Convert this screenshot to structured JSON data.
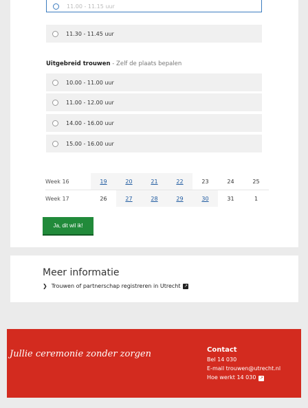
{
  "slots_top": [
    {
      "label": "11.00 - 11.15 uur",
      "selected": true
    },
    {
      "label": "11.30 - 11.45 uur",
      "selected": false
    }
  ],
  "uitgebreid": {
    "title": "Uitgebreid trouwen",
    "subtitle": " - Zelf de plaats bepalen",
    "slots": [
      "10.00 - 11.00 uur",
      "11.00 - 12.00 uur",
      "14.00 - 16.00 uur",
      "15.00 - 16.00 uur"
    ]
  },
  "weeks": [
    {
      "label": "Week 16",
      "days": [
        {
          "d": "19",
          "available": true
        },
        {
          "d": "20",
          "available": true
        },
        {
          "d": "21",
          "available": true
        },
        {
          "d": "22",
          "available": true
        },
        {
          "d": "23",
          "available": false
        },
        {
          "d": "24",
          "available": false
        },
        {
          "d": "25",
          "available": false
        }
      ]
    },
    {
      "label": "Week 17",
      "days": [
        {
          "d": "26",
          "available": false
        },
        {
          "d": "27",
          "available": true
        },
        {
          "d": "28",
          "available": true
        },
        {
          "d": "29",
          "available": true
        },
        {
          "d": "30",
          "available": true
        },
        {
          "d": "31",
          "available": false
        },
        {
          "d": "1",
          "available": false
        }
      ]
    }
  ],
  "cta_label": "Ja, dit wil ik!",
  "meer": {
    "title": "Meer informatie",
    "link": "Trouwen of partnerschap registreren in Utrecht"
  },
  "footer": {
    "tagline": "Jullie ceremonie zonder zorgen",
    "contact_title": "Contact",
    "phone": "Bel 14 030",
    "email": "E-mail trouwen@utrecht.nl",
    "how": "Hoe werkt 14 030"
  },
  "colors": {
    "footer": "#d32b1f",
    "cta": "#218a3a",
    "link": "#1e5aa0"
  }
}
